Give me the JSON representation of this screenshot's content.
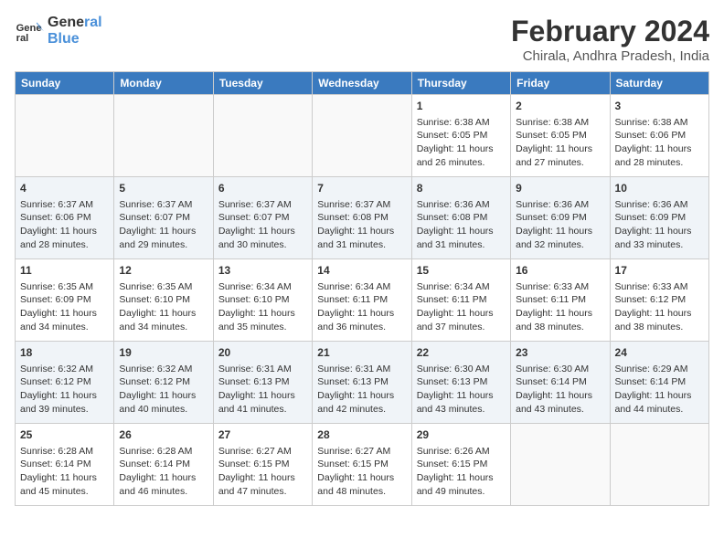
{
  "header": {
    "logo_line1": "General",
    "logo_line2": "Blue",
    "month_year": "February 2024",
    "location": "Chirala, Andhra Pradesh, India"
  },
  "weekdays": [
    "Sunday",
    "Monday",
    "Tuesday",
    "Wednesday",
    "Thursday",
    "Friday",
    "Saturday"
  ],
  "weeks": [
    [
      {
        "day": "",
        "info": ""
      },
      {
        "day": "",
        "info": ""
      },
      {
        "day": "",
        "info": ""
      },
      {
        "day": "",
        "info": ""
      },
      {
        "day": "1",
        "info": "Sunrise: 6:38 AM\nSunset: 6:05 PM\nDaylight: 11 hours\nand 26 minutes."
      },
      {
        "day": "2",
        "info": "Sunrise: 6:38 AM\nSunset: 6:05 PM\nDaylight: 11 hours\nand 27 minutes."
      },
      {
        "day": "3",
        "info": "Sunrise: 6:38 AM\nSunset: 6:06 PM\nDaylight: 11 hours\nand 28 minutes."
      }
    ],
    [
      {
        "day": "4",
        "info": "Sunrise: 6:37 AM\nSunset: 6:06 PM\nDaylight: 11 hours\nand 28 minutes."
      },
      {
        "day": "5",
        "info": "Sunrise: 6:37 AM\nSunset: 6:07 PM\nDaylight: 11 hours\nand 29 minutes."
      },
      {
        "day": "6",
        "info": "Sunrise: 6:37 AM\nSunset: 6:07 PM\nDaylight: 11 hours\nand 30 minutes."
      },
      {
        "day": "7",
        "info": "Sunrise: 6:37 AM\nSunset: 6:08 PM\nDaylight: 11 hours\nand 31 minutes."
      },
      {
        "day": "8",
        "info": "Sunrise: 6:36 AM\nSunset: 6:08 PM\nDaylight: 11 hours\nand 31 minutes."
      },
      {
        "day": "9",
        "info": "Sunrise: 6:36 AM\nSunset: 6:09 PM\nDaylight: 11 hours\nand 32 minutes."
      },
      {
        "day": "10",
        "info": "Sunrise: 6:36 AM\nSunset: 6:09 PM\nDaylight: 11 hours\nand 33 minutes."
      }
    ],
    [
      {
        "day": "11",
        "info": "Sunrise: 6:35 AM\nSunset: 6:09 PM\nDaylight: 11 hours\nand 34 minutes."
      },
      {
        "day": "12",
        "info": "Sunrise: 6:35 AM\nSunset: 6:10 PM\nDaylight: 11 hours\nand 34 minutes."
      },
      {
        "day": "13",
        "info": "Sunrise: 6:34 AM\nSunset: 6:10 PM\nDaylight: 11 hours\nand 35 minutes."
      },
      {
        "day": "14",
        "info": "Sunrise: 6:34 AM\nSunset: 6:11 PM\nDaylight: 11 hours\nand 36 minutes."
      },
      {
        "day": "15",
        "info": "Sunrise: 6:34 AM\nSunset: 6:11 PM\nDaylight: 11 hours\nand 37 minutes."
      },
      {
        "day": "16",
        "info": "Sunrise: 6:33 AM\nSunset: 6:11 PM\nDaylight: 11 hours\nand 38 minutes."
      },
      {
        "day": "17",
        "info": "Sunrise: 6:33 AM\nSunset: 6:12 PM\nDaylight: 11 hours\nand 38 minutes."
      }
    ],
    [
      {
        "day": "18",
        "info": "Sunrise: 6:32 AM\nSunset: 6:12 PM\nDaylight: 11 hours\nand 39 minutes."
      },
      {
        "day": "19",
        "info": "Sunrise: 6:32 AM\nSunset: 6:12 PM\nDaylight: 11 hours\nand 40 minutes."
      },
      {
        "day": "20",
        "info": "Sunrise: 6:31 AM\nSunset: 6:13 PM\nDaylight: 11 hours\nand 41 minutes."
      },
      {
        "day": "21",
        "info": "Sunrise: 6:31 AM\nSunset: 6:13 PM\nDaylight: 11 hours\nand 42 minutes."
      },
      {
        "day": "22",
        "info": "Sunrise: 6:30 AM\nSunset: 6:13 PM\nDaylight: 11 hours\nand 43 minutes."
      },
      {
        "day": "23",
        "info": "Sunrise: 6:30 AM\nSunset: 6:14 PM\nDaylight: 11 hours\nand 43 minutes."
      },
      {
        "day": "24",
        "info": "Sunrise: 6:29 AM\nSunset: 6:14 PM\nDaylight: 11 hours\nand 44 minutes."
      }
    ],
    [
      {
        "day": "25",
        "info": "Sunrise: 6:28 AM\nSunset: 6:14 PM\nDaylight: 11 hours\nand 45 minutes."
      },
      {
        "day": "26",
        "info": "Sunrise: 6:28 AM\nSunset: 6:14 PM\nDaylight: 11 hours\nand 46 minutes."
      },
      {
        "day": "27",
        "info": "Sunrise: 6:27 AM\nSunset: 6:15 PM\nDaylight: 11 hours\nand 47 minutes."
      },
      {
        "day": "28",
        "info": "Sunrise: 6:27 AM\nSunset: 6:15 PM\nDaylight: 11 hours\nand 48 minutes."
      },
      {
        "day": "29",
        "info": "Sunrise: 6:26 AM\nSunset: 6:15 PM\nDaylight: 11 hours\nand 49 minutes."
      },
      {
        "day": "",
        "info": ""
      },
      {
        "day": "",
        "info": ""
      }
    ]
  ]
}
